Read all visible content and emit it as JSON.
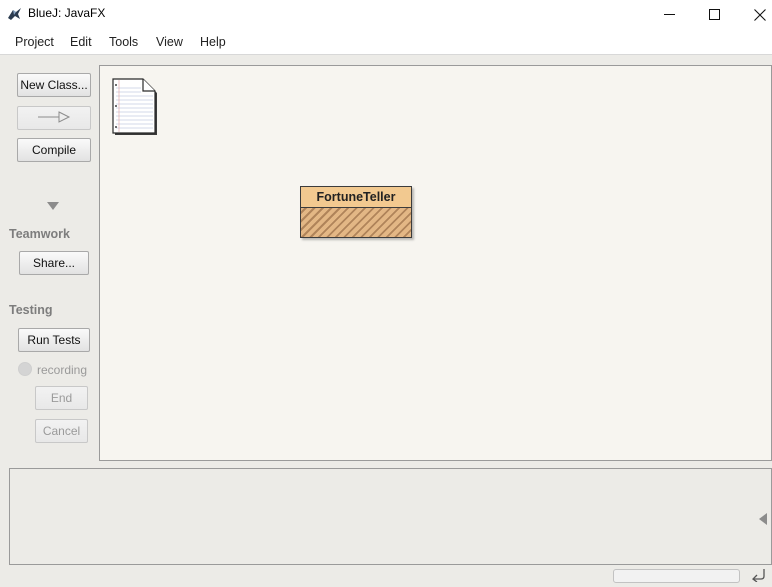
{
  "window": {
    "title": "BlueJ:  JavaFX"
  },
  "menu": [
    "Project",
    "Edit",
    "Tools",
    "View",
    "Help"
  ],
  "sidebar": {
    "new_class": "New Class...",
    "compile": "Compile",
    "teamwork_label": "Teamwork",
    "share": "Share...",
    "testing_label": "Testing",
    "run_tests": "Run Tests",
    "recording": "recording",
    "end": "End",
    "cancel": "Cancel"
  },
  "diagram": {
    "classes": [
      {
        "name": "FortuneTeller",
        "state": "uncompiled"
      }
    ]
  },
  "icons": {
    "app": "bluej-bird-icon",
    "readme": "readme-document-icon",
    "inherit_arrow": "inheritance-arrow-icon",
    "collapse": "triangle-down-icon",
    "terminal_toggle": "triangle-left-icon",
    "status": "wrap-arrow-icon"
  },
  "colors": {
    "class_header": "#f2c990",
    "class_hatch": "#b0845a",
    "canvas_bg": "#f7f5f0",
    "frame_bg": "#ecebe7"
  }
}
